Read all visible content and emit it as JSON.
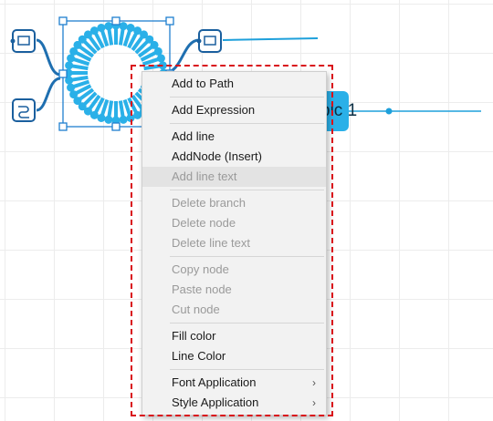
{
  "canvas": {
    "topic_label": "pic 1",
    "colors": {
      "accent": "#1ea0db",
      "node_fill": "#2ab0e8",
      "selection": "#1f7fd0",
      "dashed_frame": "#d9101a"
    }
  },
  "context_menu": {
    "groups": [
      [
        {
          "label": "Add to Path",
          "enabled": true
        }
      ],
      [
        {
          "label": "Add Expression",
          "enabled": true
        }
      ],
      [
        {
          "label": "Add line",
          "enabled": true
        },
        {
          "label": "AddNode  (Insert)",
          "enabled": true
        },
        {
          "label": "Add line text",
          "enabled": false,
          "highlighted": true
        }
      ],
      [
        {
          "label": "Delete branch",
          "enabled": false
        },
        {
          "label": "Delete node",
          "enabled": false
        },
        {
          "label": "Delete line text",
          "enabled": false
        }
      ],
      [
        {
          "label": "Copy node",
          "enabled": false
        },
        {
          "label": "Paste node",
          "enabled": false
        },
        {
          "label": "Cut node",
          "enabled": false
        }
      ],
      [
        {
          "label": "Fill color",
          "enabled": true
        },
        {
          "label": "Line Color",
          "enabled": true
        }
      ],
      [
        {
          "label": "Font Application",
          "enabled": true,
          "submenu": true
        },
        {
          "label": "Style Application",
          "enabled": true,
          "submenu": true
        }
      ]
    ],
    "submenu_icon": "chevron-right-icon"
  }
}
